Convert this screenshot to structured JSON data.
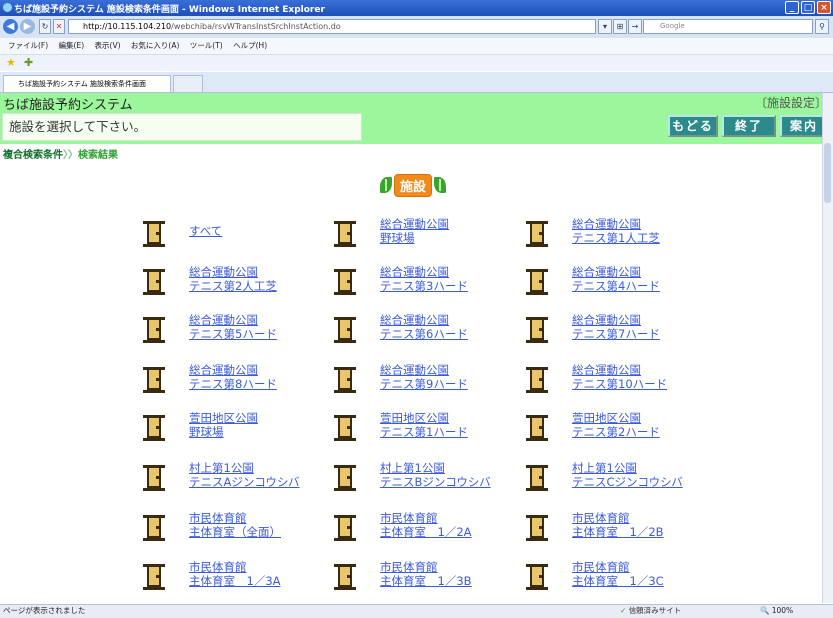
{
  "window": {
    "title": "ちば施設予約システム 施設検索条件画面 - Windows Internet Explorer",
    "url_host": "http://10.115.104.210",
    "url_path": "/webchiba/rsvWTransInstSrchInstAction.do",
    "search_placeholder": "Google",
    "tab_title": "ちば施設予約システム 施設検索条件画面"
  },
  "menubar": [
    "ファイル(F)",
    "編集(E)",
    "表示(V)",
    "お気に入り(A)",
    "ツール(T)",
    "ヘルプ(H)"
  ],
  "app": {
    "system_name": "ちば施設予約システム",
    "mode_hint": "〔施設設定〕",
    "instruction": "施設を選択して下さい。",
    "buttons": {
      "back": "もどる",
      "end": "終了",
      "guide": "案内"
    }
  },
  "breadcrumb": {
    "condition": "複合検索条件",
    "separator": "〉〉",
    "result": "検索結果"
  },
  "section_title": "施設",
  "facilities": [
    [
      "すべて",
      ""
    ],
    [
      "総合運動公園",
      "野球場"
    ],
    [
      "総合運動公園",
      "テニス第1人工芝"
    ],
    [
      "総合運動公園",
      "テニス第2人工芝"
    ],
    [
      "総合運動公園",
      "テニス第3ハード"
    ],
    [
      "総合運動公園",
      "テニス第4ハード"
    ],
    [
      "総合運動公園",
      "テニス第5ハード"
    ],
    [
      "総合運動公園",
      "テニス第6ハード"
    ],
    [
      "総合運動公園",
      "テニス第7ハード"
    ],
    [
      "総合運動公園",
      "テニス第8ハード"
    ],
    [
      "総合運動公園",
      "テニス第9ハード"
    ],
    [
      "総合運動公園",
      "テニス第10ハード"
    ],
    [
      "萱田地区公園",
      "野球場"
    ],
    [
      "萱田地区公園",
      "テニス第1ハード"
    ],
    [
      "萱田地区公園",
      "テニス第2ハード"
    ],
    [
      "村上第1公園",
      "テニスAジンコウシバ"
    ],
    [
      "村上第1公園",
      "テニスBジンコウシバ"
    ],
    [
      "村上第1公園",
      "テニスCジンコウシバ"
    ],
    [
      "市民体育館",
      "主体育室（全面）"
    ],
    [
      "市民体育館",
      "主体育室　1／2A"
    ],
    [
      "市民体育館",
      "主体育室　1／2B"
    ],
    [
      "市民体育館",
      "主体育室　1／3A"
    ],
    [
      "市民体育館",
      "主体育室　1／3B"
    ],
    [
      "市民体育館",
      "主体育室　1／3C"
    ]
  ],
  "statusbar": {
    "message": "ページが表示されました",
    "zone": "信頼済みサイト",
    "zoom": "100%"
  },
  "colors": {
    "header_green": "#9cf79c",
    "link_blue": "#3b5bdc",
    "button_teal": "#2d8a8a",
    "section_orange": "#f08a1a"
  }
}
